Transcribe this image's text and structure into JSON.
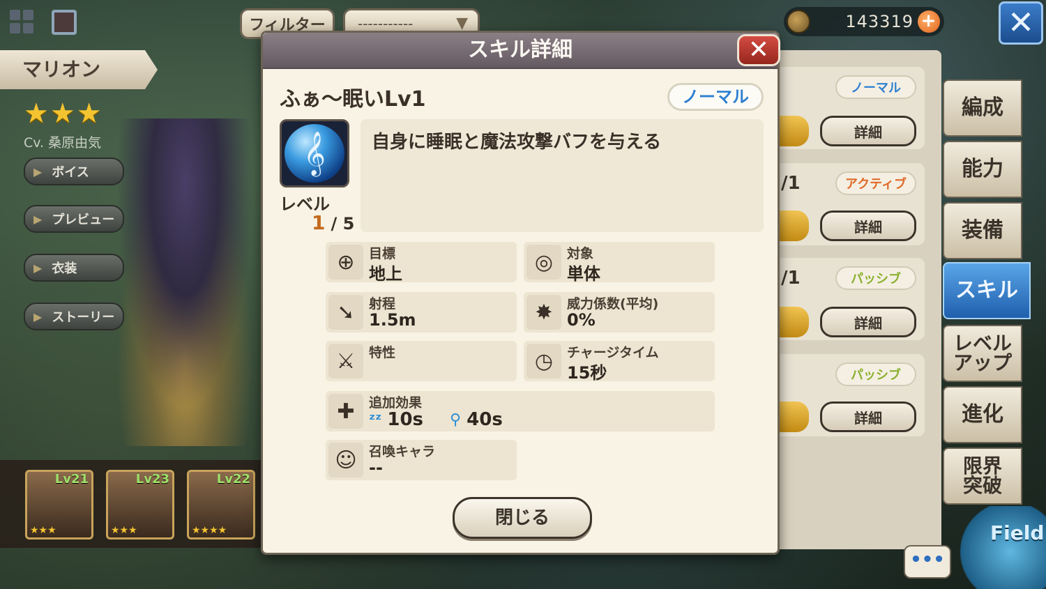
{
  "header": {
    "filter_label": "フィルター",
    "filter_select_value": "-----------",
    "currency_amount": "143319"
  },
  "character": {
    "name": "マリオン",
    "stars": "★★★",
    "cv": "Cv. 桑原由気",
    "buttons": [
      "ボイス",
      "プレビュー",
      "衣装",
      "ストーリー"
    ]
  },
  "party": [
    {
      "level": "Lv21",
      "stars": "★★★"
    },
    {
      "level": "Lv23",
      "stars": "★★★"
    },
    {
      "level": "Lv22",
      "stars": "★★★★"
    }
  ],
  "skill_list": {
    "types": [
      "ノーマル",
      "アクティブ",
      "パッシブ",
      "パッシブ"
    ],
    "type_colors": [
      "#2d7fd1",
      "#e06a2a",
      "#8ab030",
      "#8ab030"
    ],
    "detail_label": "詳細",
    "level_fragment": "/1"
  },
  "side_tabs": [
    "編成",
    "能力",
    "装備",
    "スキル",
    "レベル\nアップ",
    "進化",
    "限界\n突破"
  ],
  "active_tab": "スキル",
  "chat_label": "•••",
  "field_label": "Field",
  "popup": {
    "title": "スキル詳細",
    "skill_name": "ふぁ〜眠いLv1",
    "skill_type": "ノーマル",
    "level_label": "レベル",
    "level_current": "1",
    "level_max": "/ 5",
    "description": "自身に睡眠と魔法攻撃バフを与える",
    "stats": {
      "target": {
        "label": "目標",
        "value": "地上",
        "icon": "crosshair-icon"
      },
      "subject": {
        "label": "対象",
        "value": "単体",
        "icon": "single-target-icon"
      },
      "range": {
        "label": "射程",
        "value": "1.5m",
        "icon": "arrow-icon"
      },
      "power": {
        "label": "威力係数(平均)",
        "value": "0%",
        "icon": "burst-icon"
      },
      "trait": {
        "label": "特性",
        "value": "",
        "icon": "sword-icon"
      },
      "charge": {
        "label": "チャージタイム",
        "value": "15秒",
        "icon": "clock-icon"
      },
      "extra": {
        "label": "追加効果",
        "effect1": "10s",
        "effect2": "40s",
        "icon": "sword-plus-icon"
      },
      "summon": {
        "label": "召喚キャラ",
        "value": "--",
        "icon": "summon-icon"
      }
    },
    "close_label": "閉じる"
  }
}
